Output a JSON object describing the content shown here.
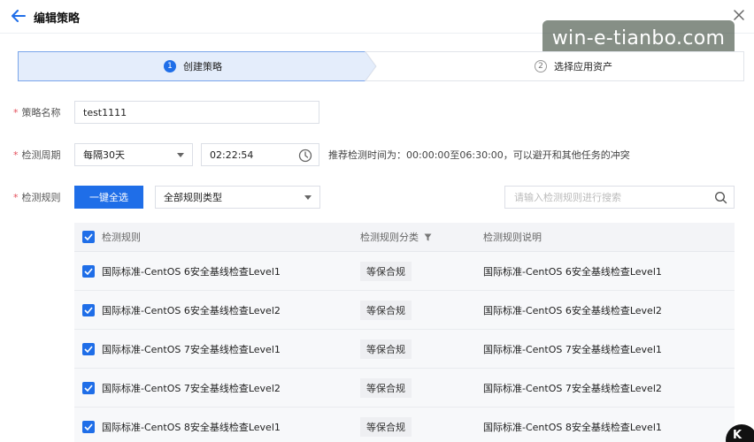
{
  "header": {
    "title": "编辑策略",
    "back_icon": "arrow-left-icon",
    "close_icon": "close-icon"
  },
  "watermark": {
    "text": "win-e-tianbo.com"
  },
  "steps": [
    {
      "num": "1",
      "label": "创建策略",
      "active": true
    },
    {
      "num": "2",
      "label": "选择应用资产",
      "active": false
    }
  ],
  "form": {
    "name_label": "策略名称",
    "name_value": "test1111",
    "period_label": "检测周期",
    "period_value": "每隔30天",
    "time_value": "02:22:54",
    "period_hint": "推荐检测时间为：00:00:00至06:30:00，可以避开和其他任务的冲突",
    "rule_label": "检测规则",
    "select_all_label": "一键全选",
    "rule_type_value": "全部规则类型",
    "search_placeholder": "请输入检测规则进行搜索"
  },
  "table": {
    "headers": [
      "检测规则",
      "检测规则分类",
      "检测规则说明"
    ],
    "rows": [
      {
        "rule": "国际标准-CentOS 6安全基线检查Level1",
        "category": "等保合规",
        "desc": "国际标准-CentOS 6安全基线检查Level1"
      },
      {
        "rule": "国际标准-CentOS 6安全基线检查Level2",
        "category": "等保合规",
        "desc": "国际标准-CentOS 6安全基线检查Level2"
      },
      {
        "rule": "国际标准-CentOS 7安全基线检查Level1",
        "category": "等保合规",
        "desc": "国际标准-CentOS 7安全基线检查Level1"
      },
      {
        "rule": "国际标准-CentOS 7安全基线检查Level2",
        "category": "等保合规",
        "desc": "国际标准-CentOS 7安全基线检查Level2"
      },
      {
        "rule": "国际标准-CentOS 8安全基线检查Level1",
        "category": "等保合规",
        "desc": "国际标准-CentOS 8安全基线检查Level1"
      }
    ]
  },
  "corner_badge": {
    "text": "K"
  },
  "colors": {
    "primary": "#1f6ee8",
    "active_step_bg": "#e4edfb",
    "required": "#e34d59"
  }
}
